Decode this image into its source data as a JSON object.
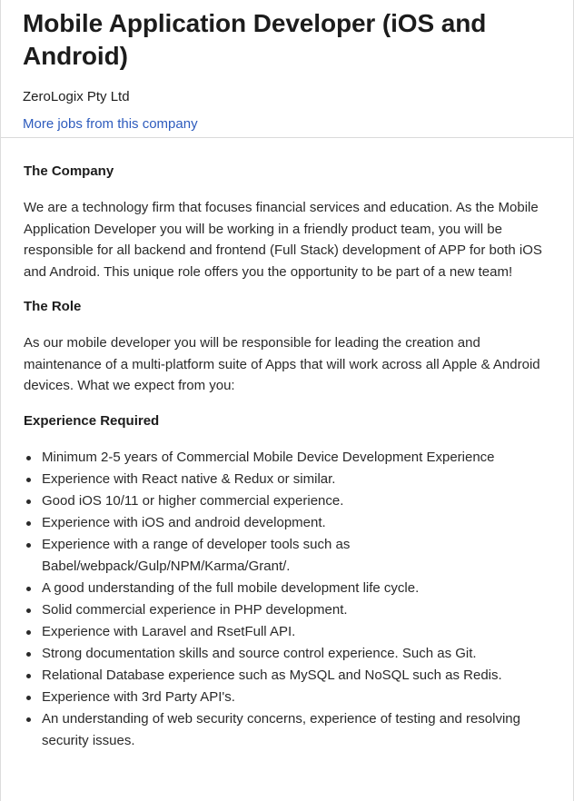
{
  "header": {
    "job_title": "Mobile Application Developer (iOS and Android)",
    "company_name": "ZeroLogix Pty Ltd",
    "more_jobs_link": "More jobs from this company"
  },
  "sections": {
    "company": {
      "heading": "The Company",
      "text": "We are a technology firm that focuses financial services and education. As the Mobile Application Developer you will be working in a friendly product team, you will be responsible for all backend and frontend (Full Stack) development of APP for both iOS and Android. This unique role offers you the opportunity to be part of a new team!"
    },
    "role": {
      "heading": "The Role",
      "text": "As our mobile developer you will be responsible for leading the creation and maintenance of a multi-platform suite of Apps that will work across all Apple & Android devices. What we expect from you:"
    },
    "experience": {
      "heading": "Experience Required",
      "items": [
        "Minimum 2-5 years of Commercial Mobile Device Development Experience",
        "Experience with React native & Redux or similar.",
        "Good iOS 10/11 or higher commercial experience.",
        "Experience with iOS and android development.",
        "Experience with a range of developer tools such as Babel/webpack/Gulp/NPM/Karma/Grant/.",
        "A good understanding of the full mobile development life cycle.",
        "Solid commercial experience in PHP development.",
        "Experience with Laravel and RsetFull API.",
        "Strong documentation skills and source control experience. Such as Git.",
        "Relational Database experience such as MySQL and NoSQL such as Redis.",
        "Experience with 3rd Party API's.",
        "An understanding of web security concerns, experience of testing and resolving security issues."
      ]
    }
  },
  "colors": {
    "link": "#2d5bbd",
    "text": "#1c1c1c",
    "divider": "#dadada"
  }
}
